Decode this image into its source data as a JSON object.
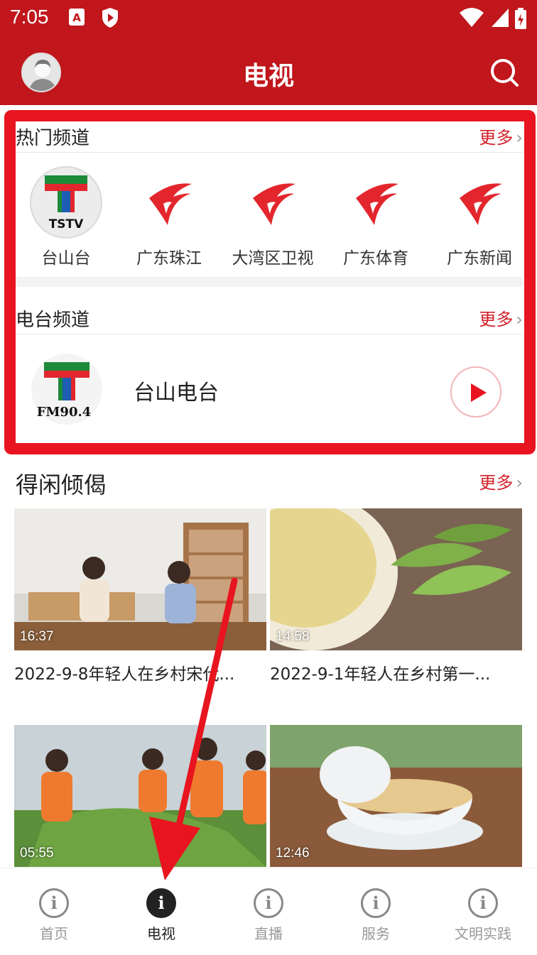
{
  "status": {
    "time": "7:05"
  },
  "header": {
    "title": "电视"
  },
  "hot_channels": {
    "title": "热门频道",
    "more": "更多",
    "items": [
      {
        "name": "台山台",
        "logo_text": "TSTV"
      },
      {
        "name": "广东珠江"
      },
      {
        "name": "大湾区卫视"
      },
      {
        "name": "广东体育"
      },
      {
        "name": "广东新闻"
      }
    ]
  },
  "radio_channels": {
    "title": "电台频道",
    "more": "更多",
    "item": {
      "name": "台山电台",
      "logo_text": "FM90.4"
    }
  },
  "leisure": {
    "title": "得闲倾偈",
    "more": "更多",
    "videos": [
      {
        "duration": "16:37",
        "title": "2022-9-8年轻人在乡村宋代..."
      },
      {
        "duration": "14:58",
        "title": "2022-9-1年轻人在乡村第一..."
      },
      {
        "duration": "05:55",
        "title": ""
      },
      {
        "duration": "12:46",
        "title": ""
      }
    ]
  },
  "tabs": [
    {
      "label": "首页",
      "icon": "info-icon"
    },
    {
      "label": "电视",
      "icon": "info-icon"
    },
    {
      "label": "直播",
      "icon": "info-icon"
    },
    {
      "label": "服务",
      "icon": "info-icon"
    },
    {
      "label": "文明实践",
      "icon": "info-icon"
    }
  ],
  "colors": {
    "brand_red": "#c0161c",
    "accent_red": "#e8141f"
  }
}
